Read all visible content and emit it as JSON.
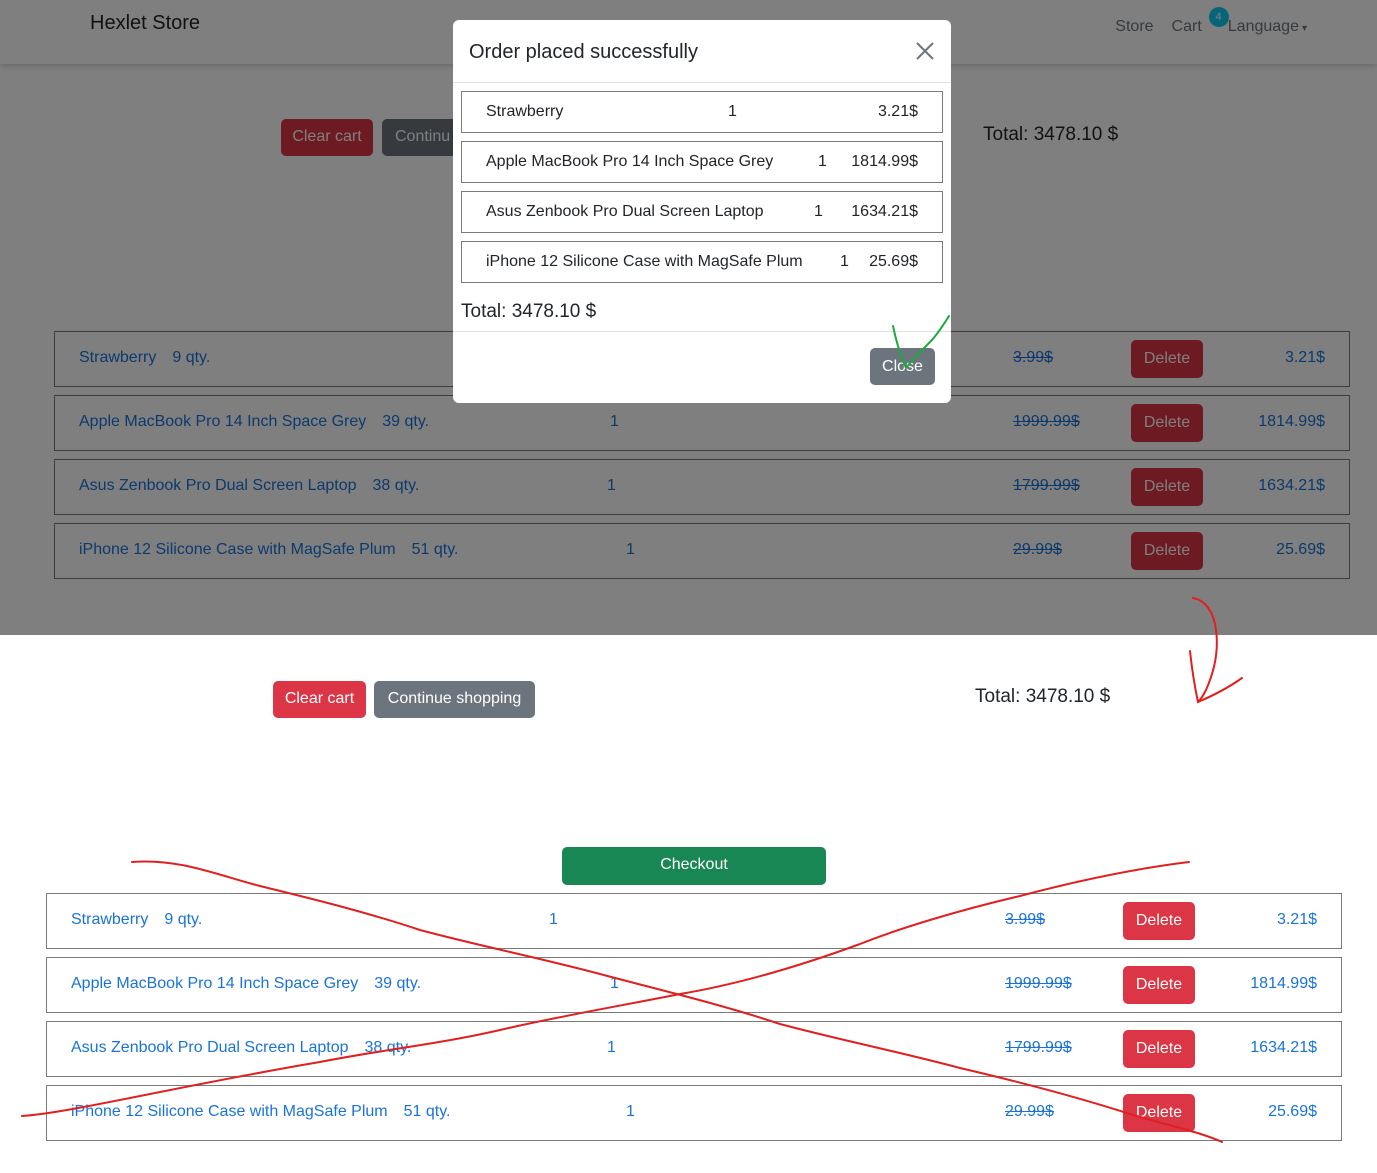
{
  "navbar": {
    "brand": "Hexlet Store",
    "links": {
      "store": "Store",
      "cart": "Cart",
      "language": "Language"
    },
    "cart_count": "4",
    "caret_icon": "▾"
  },
  "cart_controls": {
    "clear_label": "Clear cart",
    "continue_label": "Continue shopping",
    "continue_label_partial": "Continu",
    "total_text": "Total: 3478.10 $",
    "checkout_label": "Checkout"
  },
  "cart_items": [
    {
      "name": "Strawberry",
      "qty": "9 qty.",
      "count": "1",
      "old_price": "3.99$",
      "delete_label": "Delete",
      "new_price": "3.21$"
    },
    {
      "name": "Apple MacBook Pro 14 Inch Space Grey",
      "qty": "39 qty.",
      "count": "1",
      "old_price": "1999.99$",
      "delete_label": "Delete",
      "new_price": "1814.99$"
    },
    {
      "name": "Asus Zenbook Pro Dual Screen Laptop",
      "qty": "38 qty.",
      "count": "1",
      "old_price": "1799.99$",
      "delete_label": "Delete",
      "new_price": "1634.21$"
    },
    {
      "name": "iPhone 12 Silicone Case with MagSafe Plum",
      "qty": "51 qty.",
      "count": "1",
      "old_price": "29.99$",
      "delete_label": "Delete",
      "new_price": "25.69$"
    }
  ],
  "modal": {
    "title": "Order placed successfully",
    "items": [
      {
        "name": "Strawberry",
        "count": "1",
        "price": "3.21$"
      },
      {
        "name": "Apple MacBook Pro 14 Inch Space Grey",
        "count": "1",
        "price": "1814.99$"
      },
      {
        "name": "Asus Zenbook Pro Dual Screen Laptop",
        "count": "1",
        "price": "1634.21$"
      },
      {
        "name": "iPhone 12 Silicone Case with MagSafe Plum",
        "count": "1",
        "price": "25.69$"
      }
    ],
    "total_text": "Total: 3478.10 $",
    "close_label": "Close",
    "close_icon": "close-icon"
  },
  "colors": {
    "danger": "#dc3545",
    "secondary": "#6c757d",
    "success": "#198754",
    "link": "#1a73d8",
    "badge": "#0dcaf0",
    "annotation_red": "#e02020",
    "annotation_green": "#1fa83c"
  }
}
